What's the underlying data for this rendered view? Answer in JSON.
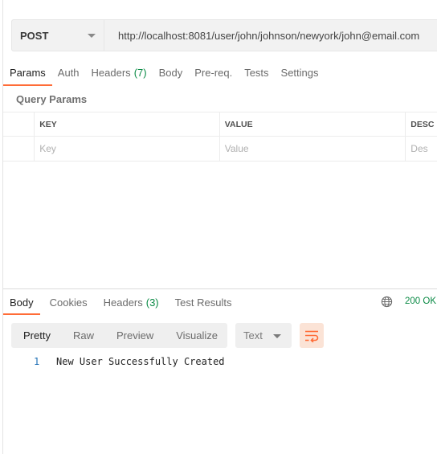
{
  "request": {
    "method": "POST",
    "url": "http://localhost:8081/user/john/johnson/newyork/john@email.com"
  },
  "request_tabs": [
    {
      "label": "Params",
      "count": ""
    },
    {
      "label": "Auth",
      "count": ""
    },
    {
      "label": "Headers",
      "count": "(7)"
    },
    {
      "label": "Body",
      "count": ""
    },
    {
      "label": "Pre-req.",
      "count": ""
    },
    {
      "label": "Tests",
      "count": ""
    },
    {
      "label": "Settings",
      "count": ""
    }
  ],
  "query_params": {
    "title": "Query Params",
    "columns": [
      "KEY",
      "VALUE",
      "DESC"
    ],
    "placeholders": [
      "Key",
      "Value",
      "Des"
    ]
  },
  "response_tabs": [
    {
      "label": "Body",
      "count": ""
    },
    {
      "label": "Cookies",
      "count": ""
    },
    {
      "label": "Headers",
      "count": "(3)"
    },
    {
      "label": "Test Results",
      "count": ""
    }
  ],
  "response": {
    "status": "200 OK",
    "view_modes": [
      "Pretty",
      "Raw",
      "Preview",
      "Visualize"
    ],
    "format": "Text",
    "lines": [
      {
        "number": "1",
        "text": "New User Successfully Created"
      }
    ]
  },
  "colors": {
    "accent": "#ff6c37",
    "status": "#0a8a45"
  },
  "icons": [
    "chevron-down-icon",
    "globe-icon",
    "wrap-lines-icon"
  ]
}
